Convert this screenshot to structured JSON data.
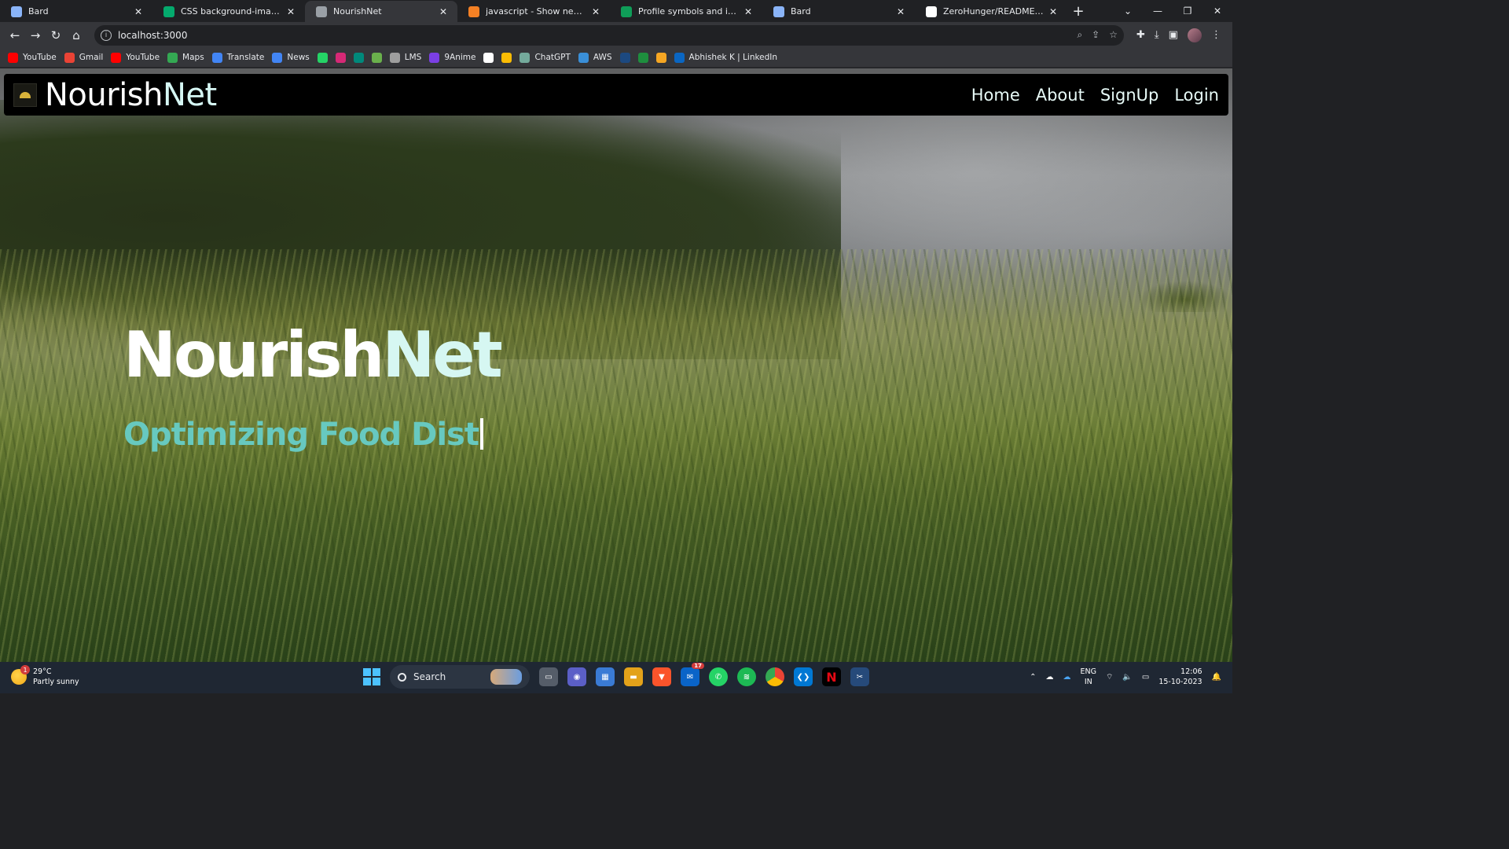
{
  "browser": {
    "tabs": [
      {
        "title": "Bard",
        "favicon": "bard-icon",
        "color": "#8ab4f8",
        "active": false
      },
      {
        "title": "CSS background-image proper",
        "favicon": "w3schools-icon",
        "color": "#04aa6d",
        "active": false
      },
      {
        "title": "NourishNet",
        "favicon": "globe-icon",
        "color": "#9aa0a6",
        "active": true
      },
      {
        "title": "javascript - Show new html pag",
        "favicon": "stackoverflow-icon",
        "color": "#f48024",
        "active": false
      },
      {
        "title": "Profile symbols and icons in W",
        "favicon": "sheets-icon",
        "color": "#0f9d58",
        "active": false
      },
      {
        "title": "Bard",
        "favicon": "bard-icon",
        "color": "#8ab4f8",
        "active": false
      },
      {
        "title": "ZeroHunger/README.md at m",
        "favicon": "github-icon",
        "color": "#ffffff",
        "active": false
      }
    ],
    "url": "localhost:3000",
    "bookmarks": [
      {
        "label": "YouTube",
        "icon": "youtube-icon",
        "color": "#ff0000"
      },
      {
        "label": "Gmail",
        "icon": "gmail-icon",
        "color": "#ea4335"
      },
      {
        "label": "YouTube",
        "icon": "youtube-icon",
        "color": "#ff0000"
      },
      {
        "label": "Maps",
        "icon": "maps-icon",
        "color": "#34a853"
      },
      {
        "label": "Translate",
        "icon": "translate-icon",
        "color": "#4285f4"
      },
      {
        "label": "News",
        "icon": "news-icon",
        "color": "#4285f4"
      },
      {
        "label": "",
        "icon": "whatsapp-icon",
        "color": "#25d366"
      },
      {
        "label": "",
        "icon": "instagram-icon",
        "color": "#d62976"
      },
      {
        "label": "",
        "icon": "meet-icon",
        "color": "#00897b"
      },
      {
        "label": "",
        "icon": "sprout-icon",
        "color": "#6ab04c"
      },
      {
        "label": "LMS",
        "icon": "lms-icon",
        "color": "#9e9e9e"
      },
      {
        "label": "9Anime",
        "icon": "play-icon",
        "color": "#7b3fe4"
      },
      {
        "label": "",
        "icon": "github-icon",
        "color": "#ffffff"
      },
      {
        "label": "",
        "icon": "drive-icon",
        "color": "#fbbc04"
      },
      {
        "label": "ChatGPT",
        "icon": "chatgpt-icon",
        "color": "#74aa9c"
      },
      {
        "label": "AWS",
        "icon": "aws-icon",
        "color": "#3a8fd8"
      },
      {
        "label": "",
        "icon": "unstop-icon",
        "color": "#1c4980"
      },
      {
        "label": "",
        "icon": "classroom-icon",
        "color": "#1e8e3e"
      },
      {
        "label": "",
        "icon": "infinity-icon",
        "color": "#f5a623"
      },
      {
        "label": "Abhishek K | LinkedIn",
        "icon": "linkedin-icon",
        "color": "#0a66c2"
      }
    ]
  },
  "site": {
    "brand_part1": "Nourish",
    "brand_part2": "Net",
    "nav": [
      "Home",
      "About",
      "SignUp",
      "Login"
    ],
    "hero_title_part1": "Nourish",
    "hero_title_part2": "Net",
    "hero_subtitle": "Optimizing Food Dist",
    "colors": {
      "nav_bg": "#000000",
      "accent_teal": "#67c9c0",
      "title_highlight": "#d6f7f2"
    }
  },
  "taskbar": {
    "weather_temp": "29°C",
    "weather_desc": "Partly sunny",
    "weather_badge": "1",
    "search_label": "Search",
    "mail_badge": "17",
    "lang_top": "ENG",
    "lang_bottom": "IN",
    "time": "12:06",
    "date": "15-10-2023"
  }
}
